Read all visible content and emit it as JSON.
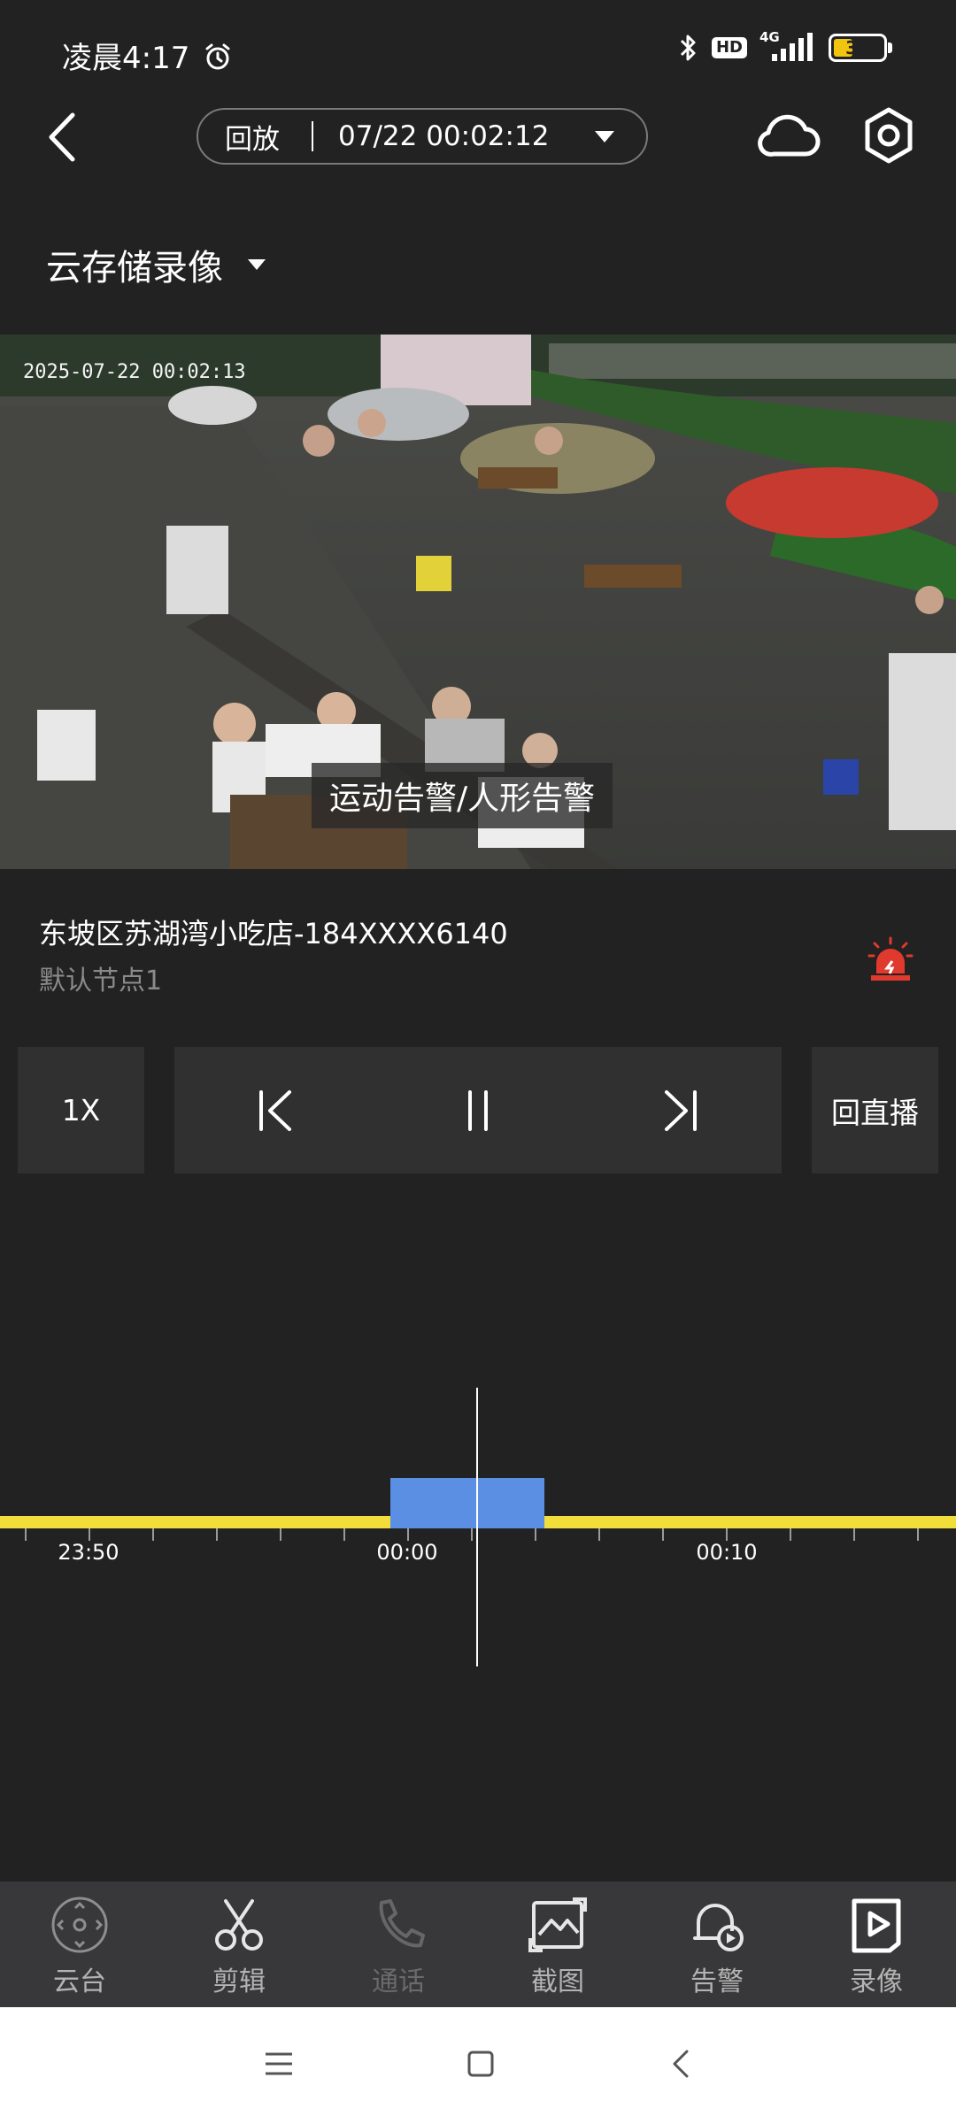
{
  "status_bar": {
    "time": "凌晨4:17",
    "hd_badge": "HD",
    "network": "4G",
    "battery": "39",
    "battery_level": 0.39,
    "battery_color": "#f1c40f"
  },
  "header": {
    "mode": "回放",
    "datetime": "07/22 00:02:12",
    "storage_label": "云存储录像"
  },
  "video": {
    "osd_timestamp": "2025-07-22 00:02:13",
    "alarm_overlay": "运动告警/人形告警"
  },
  "device": {
    "name": "东坡区苏湖湾小吃店-184XXXX6140",
    "node": "默认节点1",
    "alarm_color": "#e0392e"
  },
  "controls": {
    "speed": "1X",
    "back_to_live": "回直播"
  },
  "timeline": {
    "labels": [
      "23:50",
      "00:00",
      "00:10"
    ],
    "track_color": "#f1de3a",
    "recording_color": "#5b8fe4"
  },
  "tabs": [
    {
      "label": "云台",
      "icon": "ptz-icon"
    },
    {
      "label": "剪辑",
      "icon": "scissors-icon"
    },
    {
      "label": "通话",
      "icon": "phone-icon"
    },
    {
      "label": "截图",
      "icon": "screenshot-icon"
    },
    {
      "label": "告警",
      "icon": "alarm-bell-icon"
    },
    {
      "label": "录像",
      "icon": "record-icon"
    }
  ]
}
